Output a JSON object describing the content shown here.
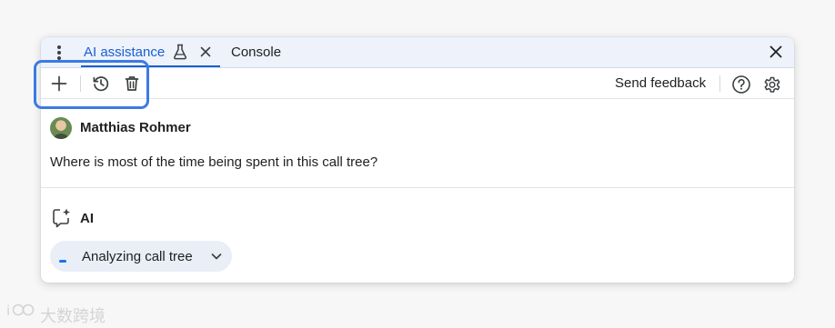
{
  "tabs": {
    "ai_assistance": "AI assistance",
    "console": "Console"
  },
  "toolbar": {
    "send_feedback": "Send feedback"
  },
  "chat": {
    "user_name": "Matthias Rohmer",
    "user_message": "Where is most of the time being spent in this call tree?",
    "ai_label": "AI",
    "step_label": "Analyzing call tree"
  },
  "watermark": {
    "text": "大数跨境"
  },
  "icons": {
    "menu": "kebab-menu-icon",
    "experiment": "flask-icon",
    "close_tab": "close-icon",
    "close_panel": "close-icon",
    "new_chat": "plus-icon",
    "history": "history-icon",
    "delete": "trash-icon",
    "help": "help-icon",
    "settings": "gear-icon",
    "ai": "ai-spark-chat-icon",
    "expand": "chevron-down-icon"
  },
  "colors": {
    "accent": "#1a5fd0",
    "tabbar_bg": "#edf2fb",
    "highlight_border": "#3b7be2",
    "step_bg": "#e9eef7"
  }
}
